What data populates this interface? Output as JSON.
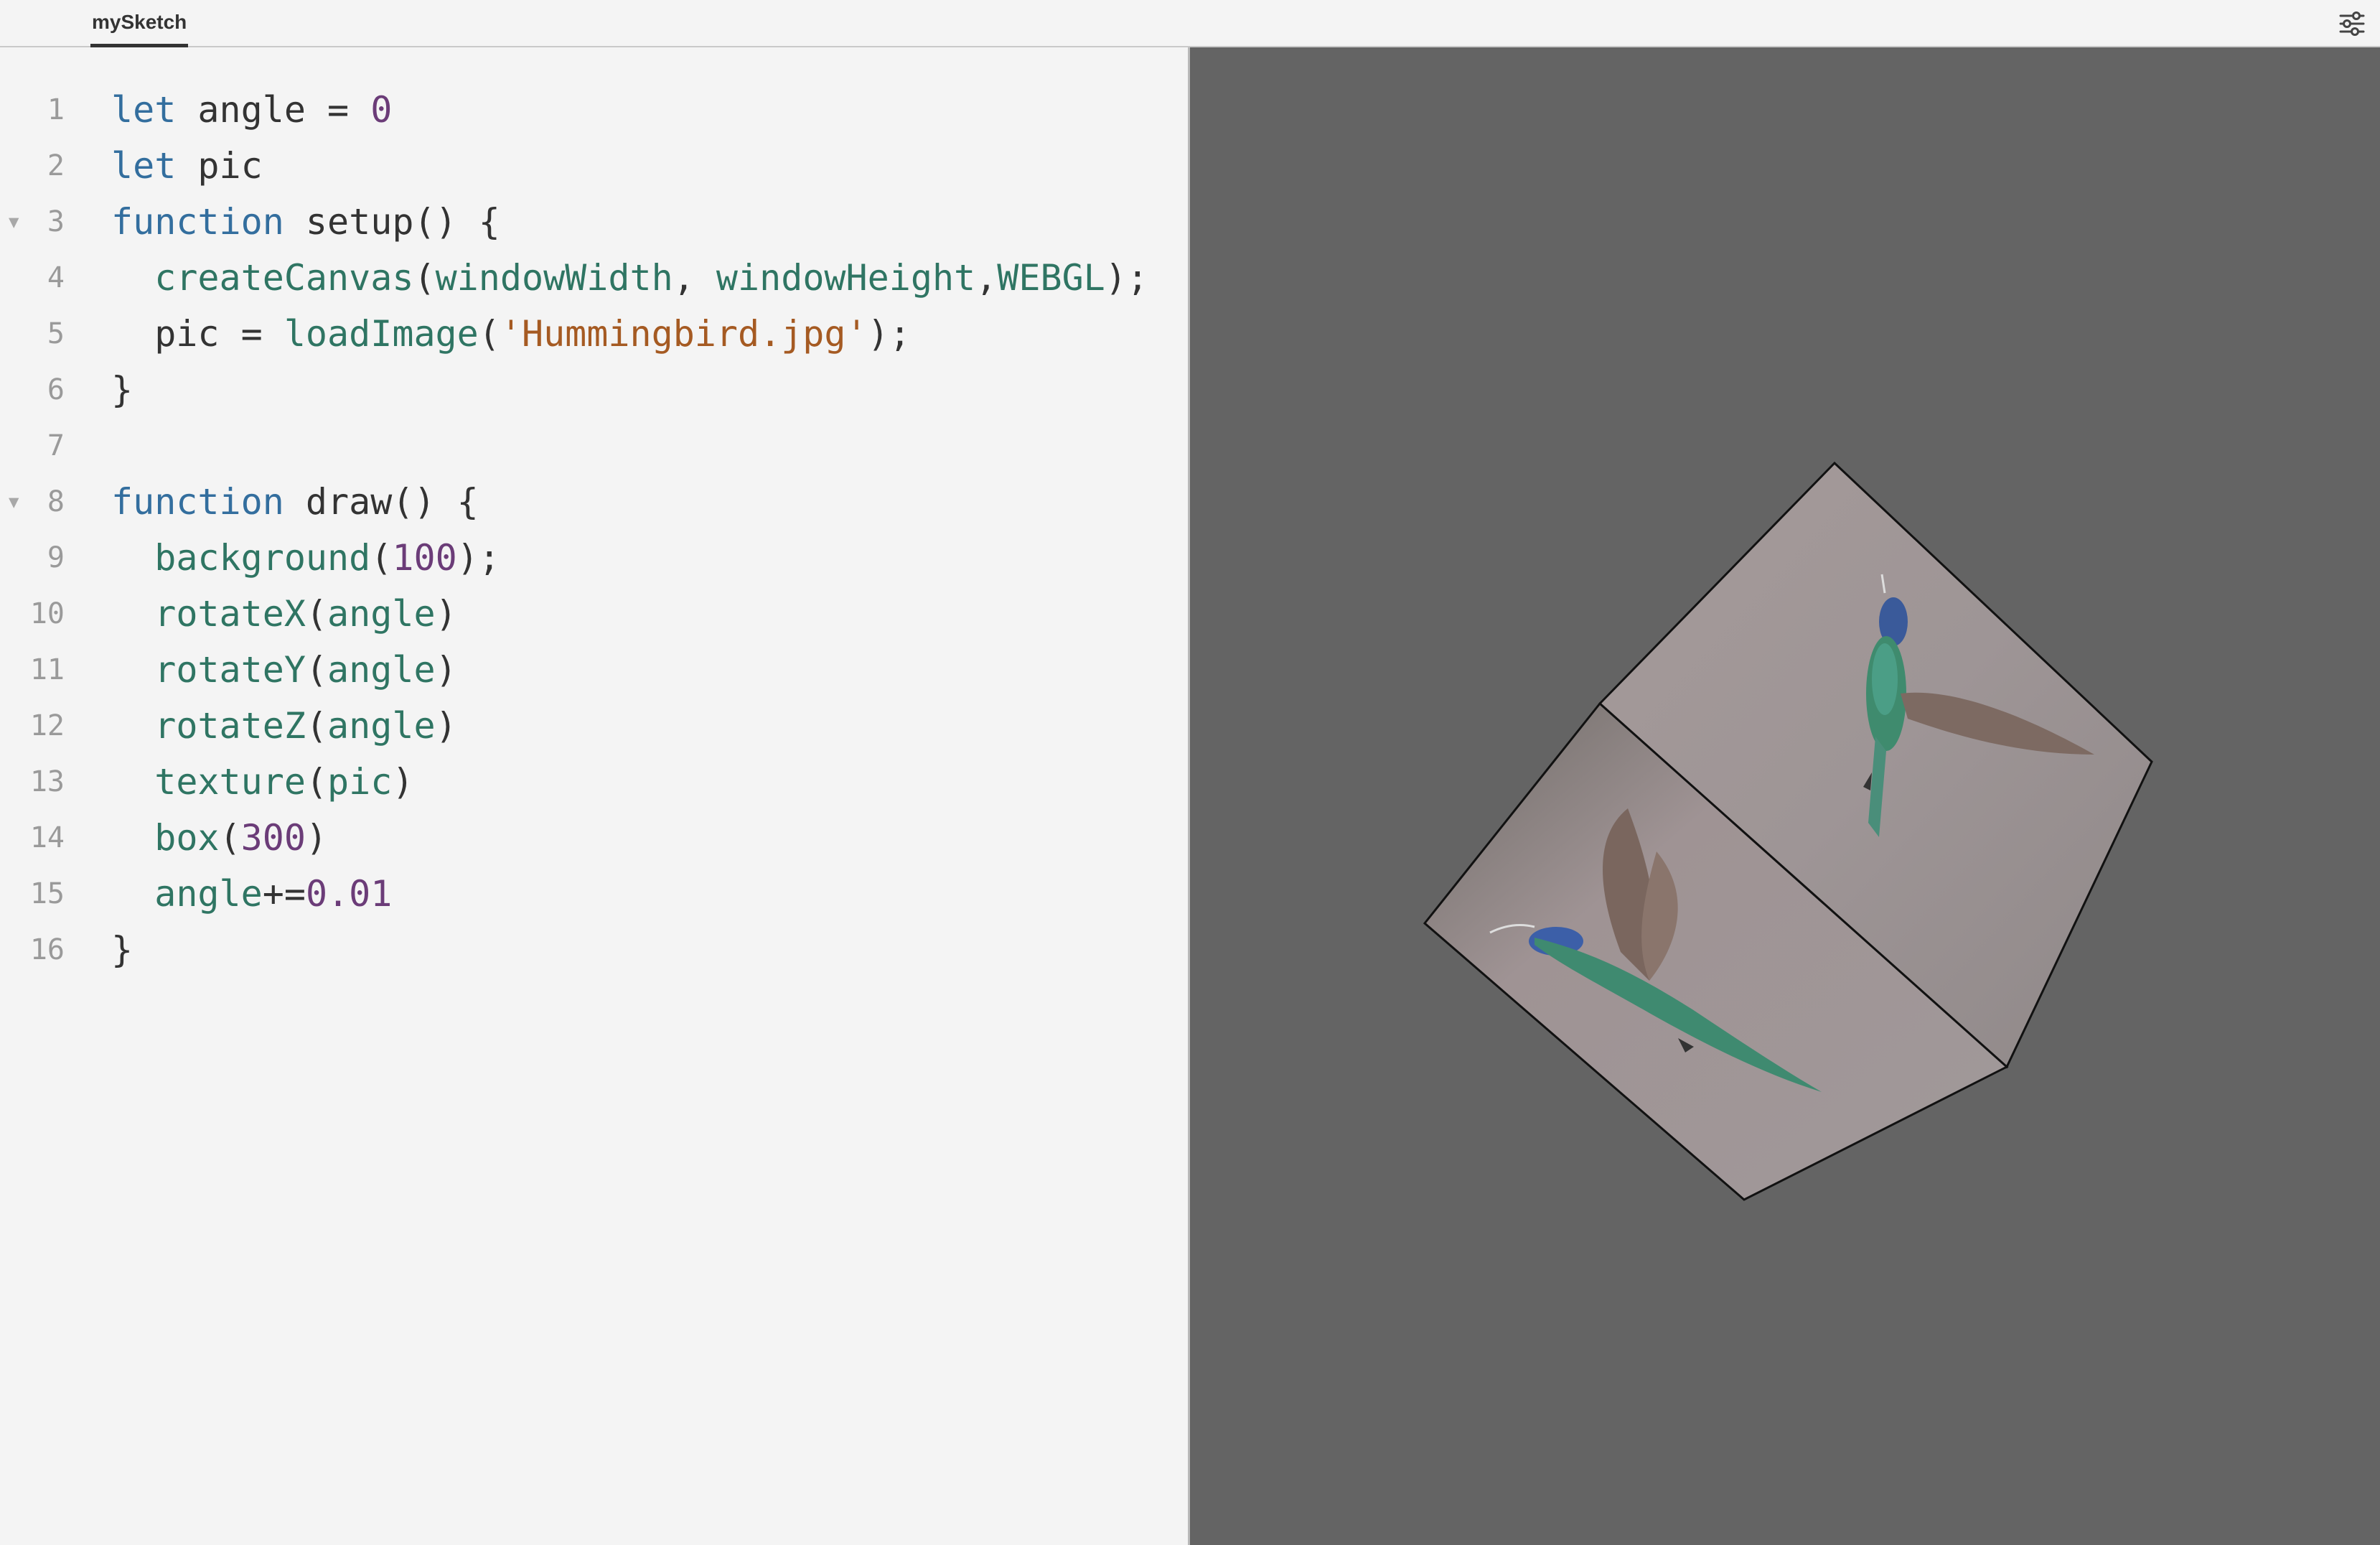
{
  "tab": {
    "label": "mySketch"
  },
  "settings": {
    "icon": "sliders-icon"
  },
  "editor": {
    "lines": [
      {
        "no": "1",
        "fold": false,
        "tokens": [
          {
            "t": "let",
            "c": "kw"
          },
          {
            "t": " angle = ",
            "c": "pl"
          },
          {
            "t": "0",
            "c": "num"
          }
        ]
      },
      {
        "no": "2",
        "fold": false,
        "tokens": [
          {
            "t": "let",
            "c": "kw"
          },
          {
            "t": " pic",
            "c": "pl"
          }
        ]
      },
      {
        "no": "3",
        "fold": true,
        "tokens": [
          {
            "t": "function",
            "c": "kw"
          },
          {
            "t": " setup() {",
            "c": "pl"
          }
        ]
      },
      {
        "no": "4",
        "fold": false,
        "tokens": [
          {
            "t": "  ",
            "c": "pl"
          },
          {
            "t": "createCanvas",
            "c": "fn"
          },
          {
            "t": "(",
            "c": "pl"
          },
          {
            "t": "windowWidth",
            "c": "fn"
          },
          {
            "t": ", ",
            "c": "pl"
          },
          {
            "t": "windowHeight",
            "c": "fn"
          },
          {
            "t": ",",
            "c": "pl"
          },
          {
            "t": "WEBGL",
            "c": "fn"
          },
          {
            "t": ");",
            "c": "pl"
          }
        ]
      },
      {
        "no": "5",
        "fold": false,
        "tokens": [
          {
            "t": "  pic = ",
            "c": "pl"
          },
          {
            "t": "loadImage",
            "c": "fn"
          },
          {
            "t": "(",
            "c": "pl"
          },
          {
            "t": "'Hummingbird.jpg'",
            "c": "str"
          },
          {
            "t": ");",
            "c": "pl"
          }
        ]
      },
      {
        "no": "6",
        "fold": false,
        "tokens": [
          {
            "t": "}",
            "c": "pl"
          }
        ]
      },
      {
        "no": "7",
        "fold": false,
        "tokens": []
      },
      {
        "no": "8",
        "fold": true,
        "tokens": [
          {
            "t": "function",
            "c": "kw"
          },
          {
            "t": " draw() {",
            "c": "pl"
          }
        ]
      },
      {
        "no": "9",
        "fold": false,
        "tokens": [
          {
            "t": "  ",
            "c": "pl"
          },
          {
            "t": "background",
            "c": "fn"
          },
          {
            "t": "(",
            "c": "pl"
          },
          {
            "t": "100",
            "c": "num"
          },
          {
            "t": ");",
            "c": "pl"
          }
        ]
      },
      {
        "no": "10",
        "fold": false,
        "tokens": [
          {
            "t": "  ",
            "c": "pl"
          },
          {
            "t": "rotateX",
            "c": "fn"
          },
          {
            "t": "(",
            "c": "pl"
          },
          {
            "t": "angle",
            "c": "fn"
          },
          {
            "t": ")",
            "c": "pl"
          }
        ]
      },
      {
        "no": "11",
        "fold": false,
        "tokens": [
          {
            "t": "  ",
            "c": "pl"
          },
          {
            "t": "rotateY",
            "c": "fn"
          },
          {
            "t": "(",
            "c": "pl"
          },
          {
            "t": "angle",
            "c": "fn"
          },
          {
            "t": ")",
            "c": "pl"
          }
        ]
      },
      {
        "no": "12",
        "fold": false,
        "tokens": [
          {
            "t": "  ",
            "c": "pl"
          },
          {
            "t": "rotateZ",
            "c": "fn"
          },
          {
            "t": "(",
            "c": "pl"
          },
          {
            "t": "angle",
            "c": "fn"
          },
          {
            "t": ")",
            "c": "pl"
          }
        ]
      },
      {
        "no": "13",
        "fold": false,
        "tokens": [
          {
            "t": "  ",
            "c": "pl"
          },
          {
            "t": "texture",
            "c": "fn"
          },
          {
            "t": "(",
            "c": "pl"
          },
          {
            "t": "pic",
            "c": "fn"
          },
          {
            "t": ")",
            "c": "pl"
          }
        ]
      },
      {
        "no": "14",
        "fold": false,
        "tokens": [
          {
            "t": "  ",
            "c": "pl"
          },
          {
            "t": "box",
            "c": "fn"
          },
          {
            "t": "(",
            "c": "pl"
          },
          {
            "t": "300",
            "c": "num"
          },
          {
            "t": ")",
            "c": "pl"
          }
        ]
      },
      {
        "no": "15",
        "fold": false,
        "tokens": [
          {
            "t": "  ",
            "c": "pl"
          },
          {
            "t": "angle",
            "c": "fn"
          },
          {
            "t": "+=",
            "c": "pl"
          },
          {
            "t": "0.01",
            "c": "num"
          }
        ]
      },
      {
        "no": "16",
        "fold": false,
        "tokens": [
          {
            "t": "}",
            "c": "pl"
          }
        ]
      }
    ]
  },
  "preview": {
    "background": "#646464",
    "subject": "textured-cube-hummingbird"
  }
}
